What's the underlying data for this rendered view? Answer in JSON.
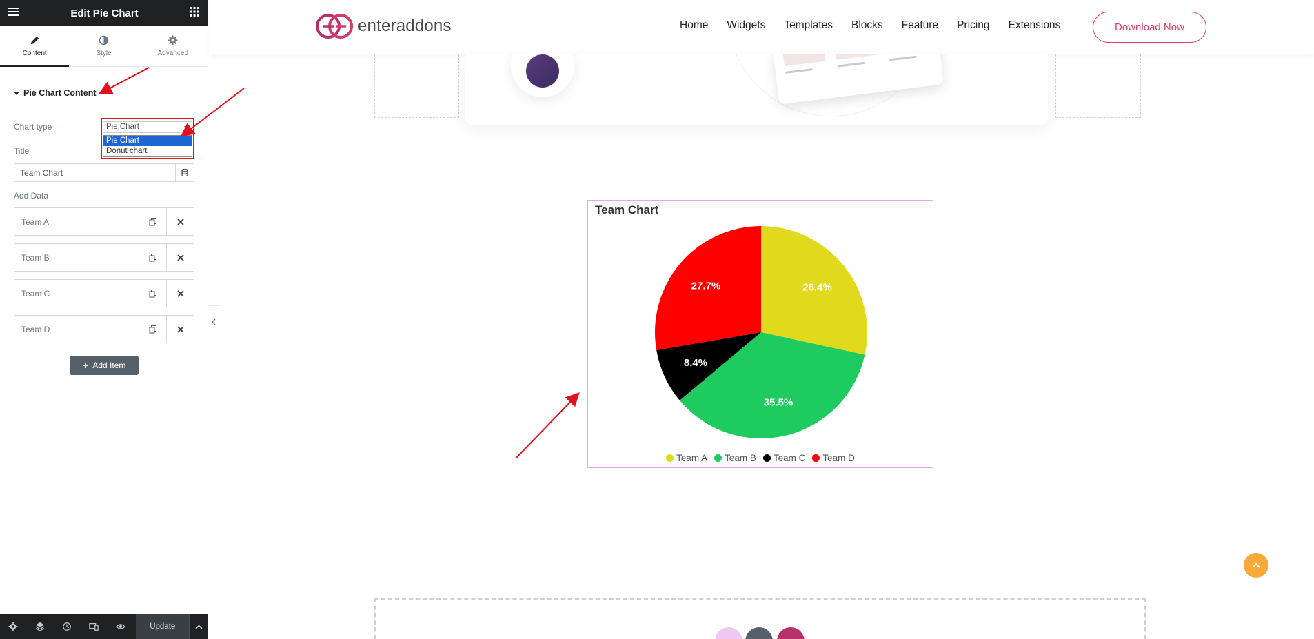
{
  "sidebar": {
    "header_title": "Edit Pie Chart",
    "tabs": [
      {
        "label": "Content"
      },
      {
        "label": "Style"
      },
      {
        "label": "Advanced"
      }
    ],
    "section_title": "Pie Chart Content",
    "chart_type_label": "Chart type",
    "chart_type_value": "Pie Chart",
    "chart_type_options": [
      "Pie Chart",
      "Donut chart"
    ],
    "title_label": "Title",
    "title_value": "Team Chart",
    "add_data_label": "Add Data",
    "items": [
      {
        "label": "Team A"
      },
      {
        "label": "Team B"
      },
      {
        "label": "Team C"
      },
      {
        "label": "Team D"
      }
    ],
    "add_item_label": "Add Item",
    "update_label": "Update"
  },
  "site": {
    "logo_text": "enteraddons",
    "nav": [
      "Home",
      "Widgets",
      "Templates",
      "Blocks",
      "Feature",
      "Pricing",
      "Extensions"
    ],
    "download_label": "Download Now"
  },
  "chart_data": {
    "type": "pie",
    "title": "Team Chart",
    "categories": [
      "Team A",
      "Team B",
      "Team C",
      "Team D"
    ],
    "values": [
      28.4,
      35.5,
      8.4,
      27.7
    ],
    "labels": [
      "28.4%",
      "35.5%",
      "8.4%",
      "27.7%"
    ],
    "colors": [
      "#e1d91b",
      "#1ecb5e",
      "#000000",
      "#ff0000"
    ],
    "legend_position": "bottom"
  },
  "colors": {
    "accent": "#e23a67",
    "editor_dark": "#1f2124",
    "annotation": "#e3101d"
  }
}
